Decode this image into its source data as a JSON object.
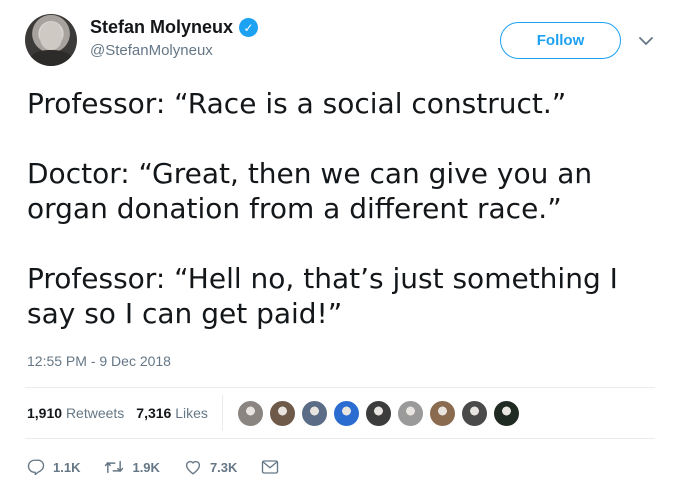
{
  "user": {
    "name": "Stefan Molyneux",
    "handle": "@StefanMolyneux",
    "verified_glyph": "✓"
  },
  "follow_label": "Follow",
  "tweet": {
    "paragraphs": [
      "Professor: “Race is a social construct.”",
      "Doctor: “Great, then we can give you an organ donation from a different race.”",
      "Professor: “Hell no, that’s just something I say so I can get paid!”"
    ],
    "timestamp": "12:55 PM - 9 Dec 2018"
  },
  "stats": {
    "retweets_count": "1,910",
    "retweets_label": "Retweets",
    "likes_count": "7,316",
    "likes_label": "Likes"
  },
  "likers": [
    {
      "icon": "user-avatar-icon",
      "color": "#8a8580"
    },
    {
      "icon": "user-avatar-icon",
      "color": "#6f5a4a"
    },
    {
      "icon": "user-avatar-icon",
      "color": "#5b6c86"
    },
    {
      "icon": "user-avatar-icon",
      "color": "#2b6cd1"
    },
    {
      "icon": "user-avatar-icon",
      "color": "#3c3c3c"
    },
    {
      "icon": "user-avatar-icon",
      "color": "#9a9a9a"
    },
    {
      "icon": "user-avatar-icon",
      "color": "#8a6b50"
    },
    {
      "icon": "user-avatar-icon",
      "color": "#4a4a4a"
    },
    {
      "icon": "user-avatar-icon",
      "color": "#1f2a22"
    }
  ],
  "actions": {
    "reply_count": "1.1K",
    "retweet_count": "1.9K",
    "like_count": "7.3K"
  },
  "colors": {
    "accent": "#1da1f2",
    "muted": "#657786",
    "text": "#14171a"
  }
}
